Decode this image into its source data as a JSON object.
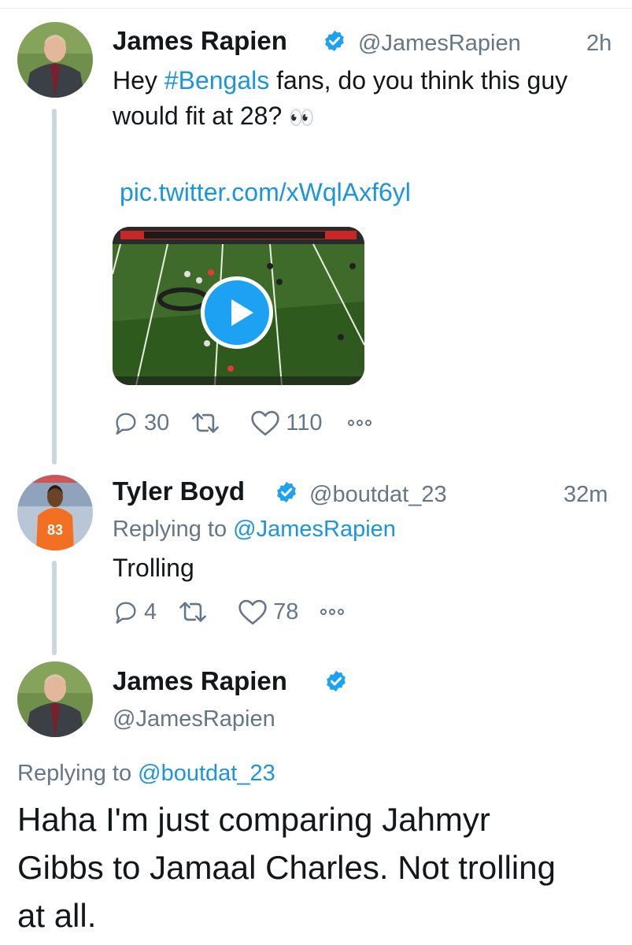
{
  "colors": {
    "link": "#1b95e0",
    "verified": "#1da1f2",
    "muted": "#657786",
    "thread_line": "#ccd6dd"
  },
  "tweet1": {
    "name": "James Rapien",
    "handle": "@JamesRapien",
    "time": "2h",
    "text_before": "Hey ",
    "hashtag": "#Bengals",
    "text_after": " fans, do you think this guy would fit at 28? ",
    "emoji": "👀",
    "pic_link": "pic.twitter.com/xWqlAxf6yl",
    "media": {
      "type": "video",
      "icon": "play-icon"
    },
    "replies": "30",
    "likes": "110"
  },
  "tweet2": {
    "name": "Tyler Boyd",
    "handle": "@boutdat_23",
    "time": "32m",
    "replying_label": "Replying to ",
    "replying_handle": "@JamesRapien",
    "text": "Trolling",
    "jersey_number": "83",
    "replies": "4",
    "likes": "78"
  },
  "tweet3": {
    "name": "James Rapien",
    "handle": "@JamesRapien",
    "replying_label": "Replying to ",
    "replying_handle": "@boutdat_23",
    "text": "Haha I'm just comparing Jahmyr Gibbs to Jamaal Charles. Not trolling at all."
  },
  "icons": [
    "reply-icon",
    "retweet-icon",
    "like-icon",
    "more-icon",
    "verified-icon",
    "play-icon"
  ]
}
